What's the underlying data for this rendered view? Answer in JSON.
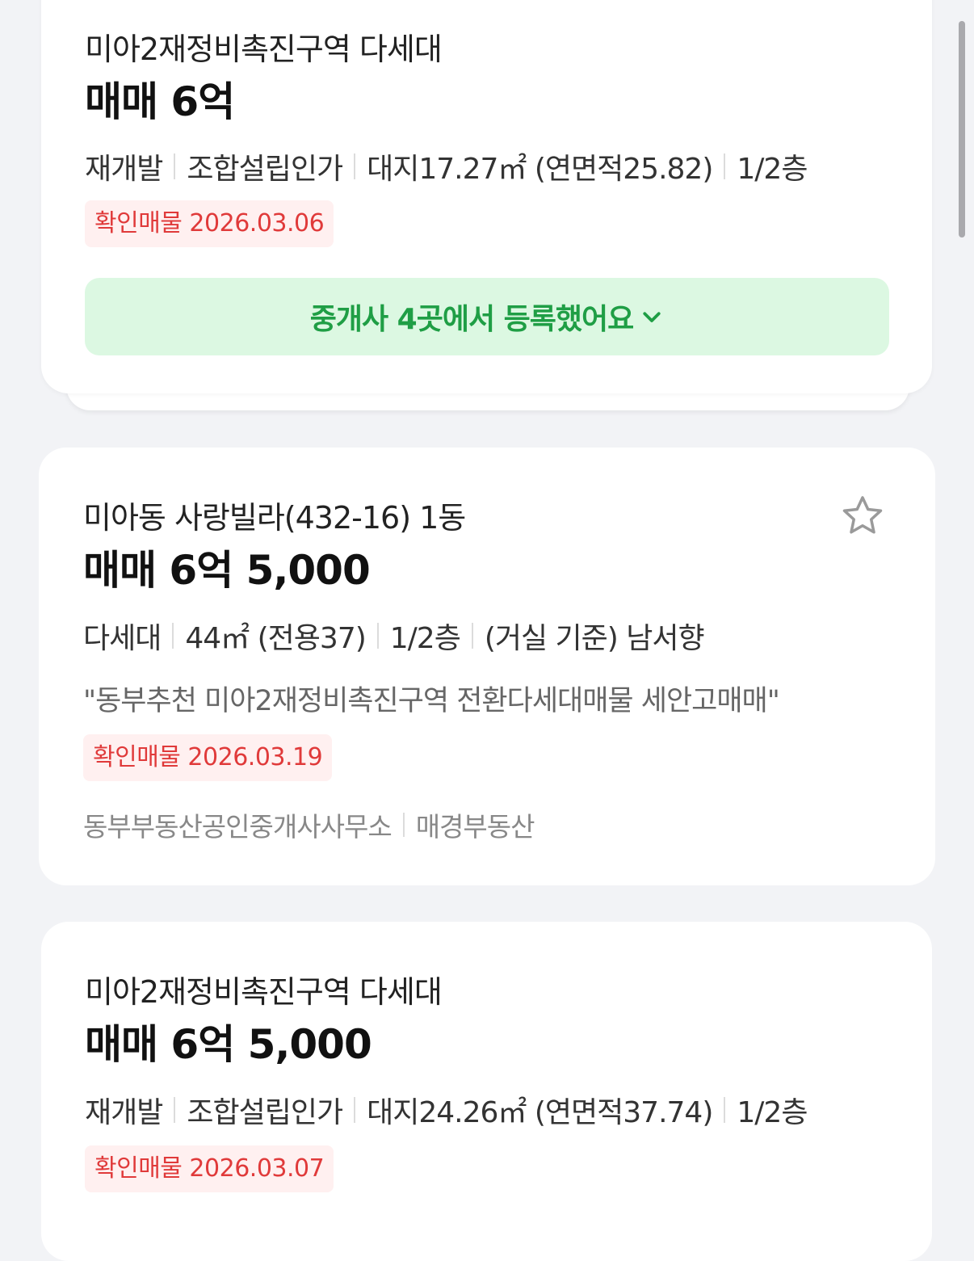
{
  "listings": [
    {
      "title": "미아2재정비촉진구역 다세대",
      "price": "매매 6억",
      "specs": [
        "재개발",
        "조합설립인가",
        "대지17.27㎡ (연면적25.82)",
        "1/2층"
      ],
      "badge": "확인매물 2026.03.06",
      "agent_button_label": "중개사 4곳에서 등록했어요"
    },
    {
      "title": "미아동 사랑빌라(432-16) 1동",
      "price": "매매 6억 5,000",
      "specs": [
        "다세대",
        "44㎡ (전용37)",
        "1/2층",
        "(거실 기준) 남서향"
      ],
      "description": "\"동부추천 미아2재정비촉진구역 전환다세대매물 세안고매매\"",
      "badge": "확인매물 2026.03.19",
      "agents": [
        "동부부동산공인중개사사무소",
        "매경부동산"
      ],
      "star_icon": "star-outline-icon"
    },
    {
      "title": "미아2재정비촉진구역 다세대",
      "price": "매매 6억 5,000",
      "specs": [
        "재개발",
        "조합설립인가",
        "대지24.26㎡ (연면적37.74)",
        "1/2층"
      ],
      "badge": "확인매물 2026.03.07"
    }
  ],
  "colors": {
    "background": "#f2f3f6",
    "card": "#ffffff",
    "badge_text": "#e03a3a",
    "badge_bg": "#fff0f0",
    "agent_button_bg": "#dcf8e2",
    "agent_button_text": "#1f9e45"
  }
}
